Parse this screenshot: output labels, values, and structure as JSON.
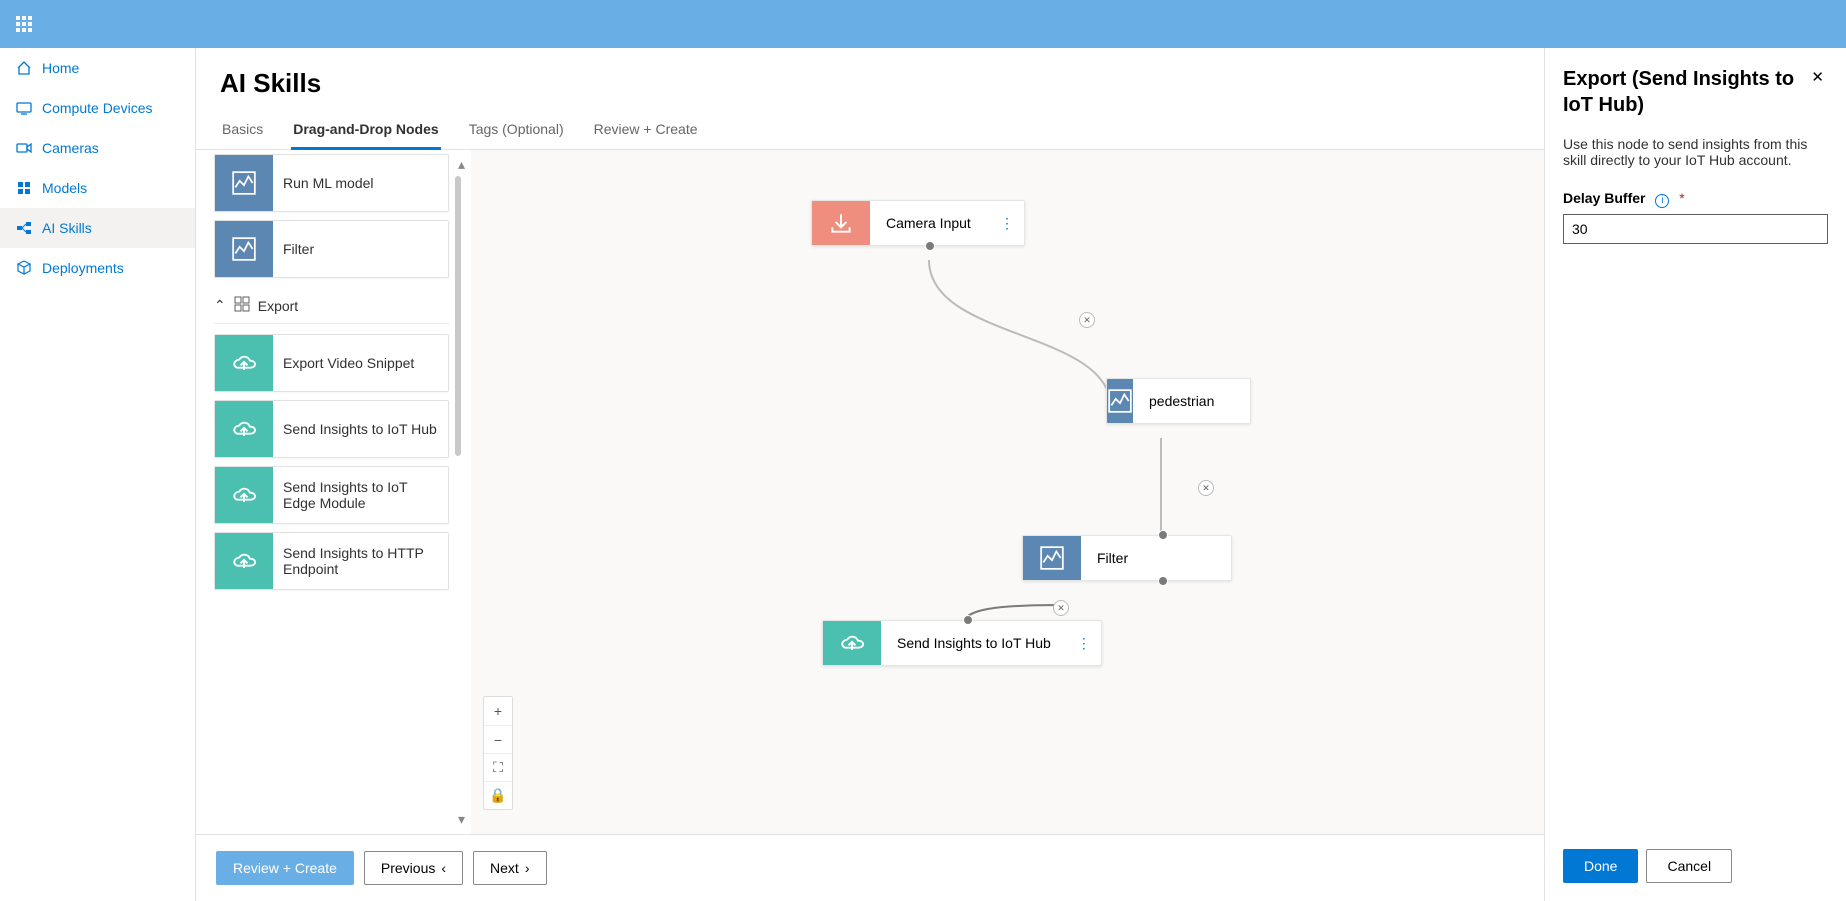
{
  "sidebar": {
    "items": [
      {
        "label": "Home"
      },
      {
        "label": "Compute Devices"
      },
      {
        "label": "Cameras"
      },
      {
        "label": "Models"
      },
      {
        "label": "AI Skills"
      },
      {
        "label": "Deployments"
      }
    ]
  },
  "page": {
    "title": "AI Skills"
  },
  "tabs": [
    {
      "label": "Basics"
    },
    {
      "label": "Drag-and-Drop Nodes"
    },
    {
      "label": "Tags (Optional)"
    },
    {
      "label": "Review + Create"
    }
  ],
  "palette": {
    "model_items": [
      {
        "label": "Run ML model"
      },
      {
        "label": "Filter"
      }
    ],
    "export_heading": "Export",
    "export_items": [
      {
        "label": "Export Video Snippet"
      },
      {
        "label": "Send Insights to IoT Hub"
      },
      {
        "label": "Send Insights to IoT Edge Module"
      },
      {
        "label": "Send Insights to HTTP Endpoint"
      }
    ]
  },
  "canvas": {
    "nodes": {
      "camera": "Camera Input",
      "pedestrian": "pedestrian",
      "filter": "Filter",
      "iothub": "Send Insights to IoT Hub"
    }
  },
  "footer": {
    "primary": "Review + Create",
    "prev": "Previous",
    "next": "Next"
  },
  "panel": {
    "title": "Export (Send Insights to IoT Hub)",
    "description": "Use this node to send insights from this skill directly to your IoT Hub account.",
    "field_label": "Delay Buffer",
    "value": "30",
    "done": "Done",
    "cancel": "Cancel"
  }
}
